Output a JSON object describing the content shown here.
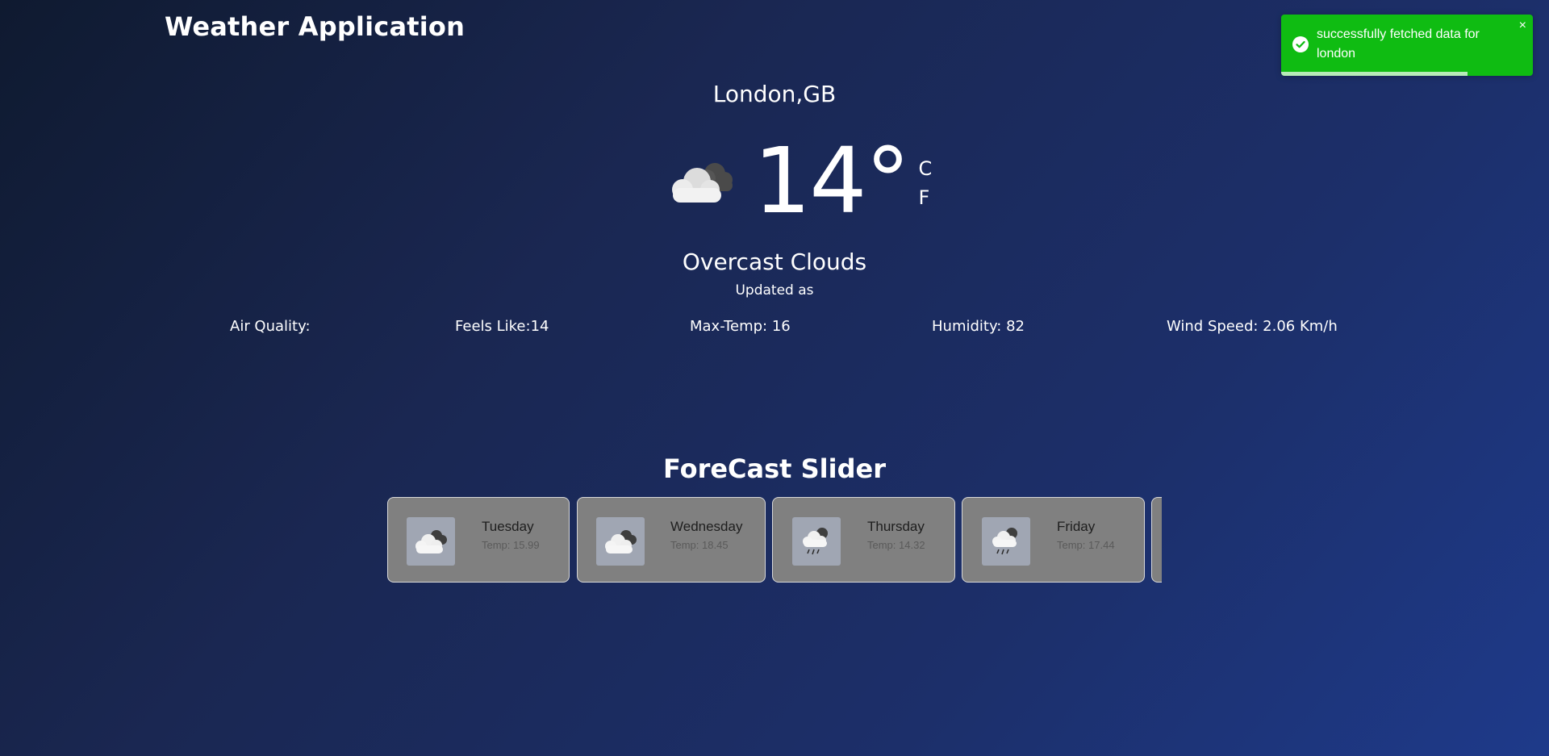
{
  "app": {
    "title": "Weather Application"
  },
  "current": {
    "location": "London,GB",
    "temperature": "14°",
    "icon": "overcast-clouds-icon",
    "units": {
      "celsius": "C",
      "fahrenheit": "F"
    },
    "condition": "Overcast Clouds",
    "updated": "Updated as"
  },
  "details": {
    "air_quality": "Air Quality:",
    "feels_like": "Feels Like:14",
    "max_temp": "Max-Temp: 16",
    "humidity": "Humidity: 82",
    "wind_speed": "Wind Speed: 2.06 Km/h"
  },
  "forecast": {
    "title": "ForeCast Slider",
    "days": [
      {
        "day": "Tuesday",
        "temp": "Temp: 15.99",
        "icon": "broken-clouds-icon"
      },
      {
        "day": "Wednesday",
        "temp": "Temp: 18.45",
        "icon": "broken-clouds-icon"
      },
      {
        "day": "Thursday",
        "temp": "Temp: 14.32",
        "icon": "rain-cloud-icon"
      },
      {
        "day": "Friday",
        "temp": "Temp: 17.44",
        "icon": "rain-cloud-icon"
      }
    ]
  },
  "toast": {
    "message": "successfully fetched data for london",
    "close": "×",
    "progress": 0.74,
    "color": "#0fbc12"
  }
}
